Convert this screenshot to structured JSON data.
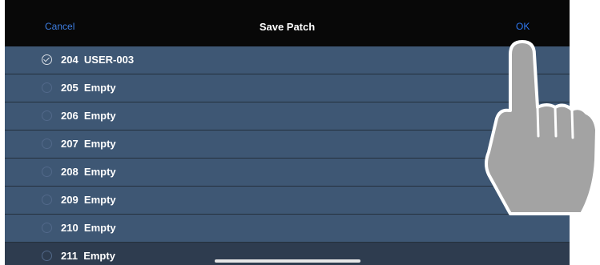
{
  "header": {
    "cancel_label": "Cancel",
    "title": "Save Patch",
    "ok_label": "OK"
  },
  "patches": [
    {
      "label": "204  USER-003",
      "selected": true
    },
    {
      "label": "205  Empty",
      "selected": false
    },
    {
      "label": "206  Empty",
      "selected": false
    },
    {
      "label": "207  Empty",
      "selected": false
    },
    {
      "label": "208  Empty",
      "selected": false
    },
    {
      "label": "209  Empty",
      "selected": false
    },
    {
      "label": "210  Empty",
      "selected": false
    },
    {
      "label": "211  Empty",
      "selected": false
    }
  ],
  "icons": {
    "pointer": "pointing-hand-icon",
    "check": "check-circle-icon",
    "radio": "radio-circle-icon"
  },
  "colors": {
    "accent": "#2f78f0",
    "row": "#3e5774",
    "header": "#080808"
  }
}
